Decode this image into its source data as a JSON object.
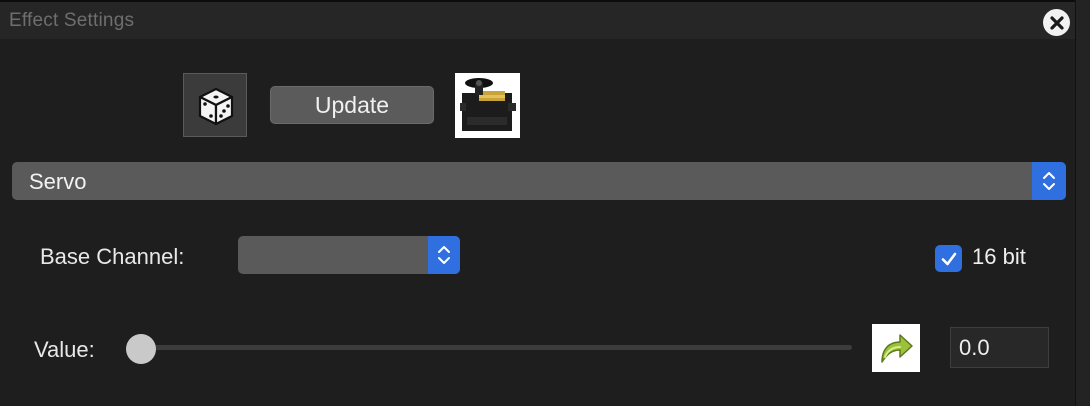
{
  "window": {
    "title": "Effect Settings",
    "close_icon": "close-circle-icon"
  },
  "toolbar": {
    "randomize_icon": "dice-icon",
    "update_label": "Update",
    "preview_icon": "servo-motor-icon"
  },
  "effect_select": {
    "selected": "Servo"
  },
  "base_channel": {
    "label": "Base Channel:",
    "selected": ""
  },
  "sixteen_bit": {
    "label": "16 bit",
    "checked": true
  },
  "value": {
    "label": "Value:",
    "slider_fraction": 0.0,
    "reset_icon": "redo-arrow-icon",
    "input_value": "0.0"
  },
  "colors": {
    "accent": "#2f6fe0",
    "background": "#1e1e1e",
    "control": "#5a5a5a"
  }
}
